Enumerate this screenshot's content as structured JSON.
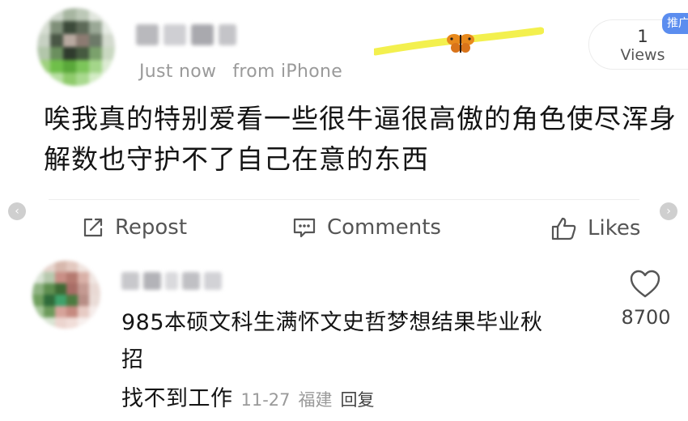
{
  "post": {
    "meta_time": "Just now",
    "meta_from": "from iPhone",
    "body_lines": [
      "唉我真的特别爱看一些很牛逼很高傲的角色使尽浑身",
      "解数也守护不了自己在意的东西"
    ],
    "views_count": "1",
    "views_label": "Views",
    "promo_tag": "推广",
    "highlight_color": "#f2ee3b",
    "butterfly_color": "#e8891c"
  },
  "actions": {
    "repost_label": "Repost",
    "comments_label": "Comments",
    "likes_label": "Likes"
  },
  "comment": {
    "text_lines": [
      "985本硕文科生满怀文史哲梦想结果毕业秋",
      "招"
    ],
    "text_continuation": "找不到工作",
    "date": "11-27",
    "location": "福建",
    "reply_label": "回复",
    "like_count": "8700"
  },
  "icons": {
    "repost": "repost-icon",
    "comments": "comment-icon",
    "likes": "thumbs-up-icon",
    "comment_like": "heart-icon",
    "nav_left": "chevron-left-icon",
    "nav_right": "chevron-right-icon"
  },
  "nav": {
    "left_glyph": "‹",
    "right_glyph": "›"
  }
}
